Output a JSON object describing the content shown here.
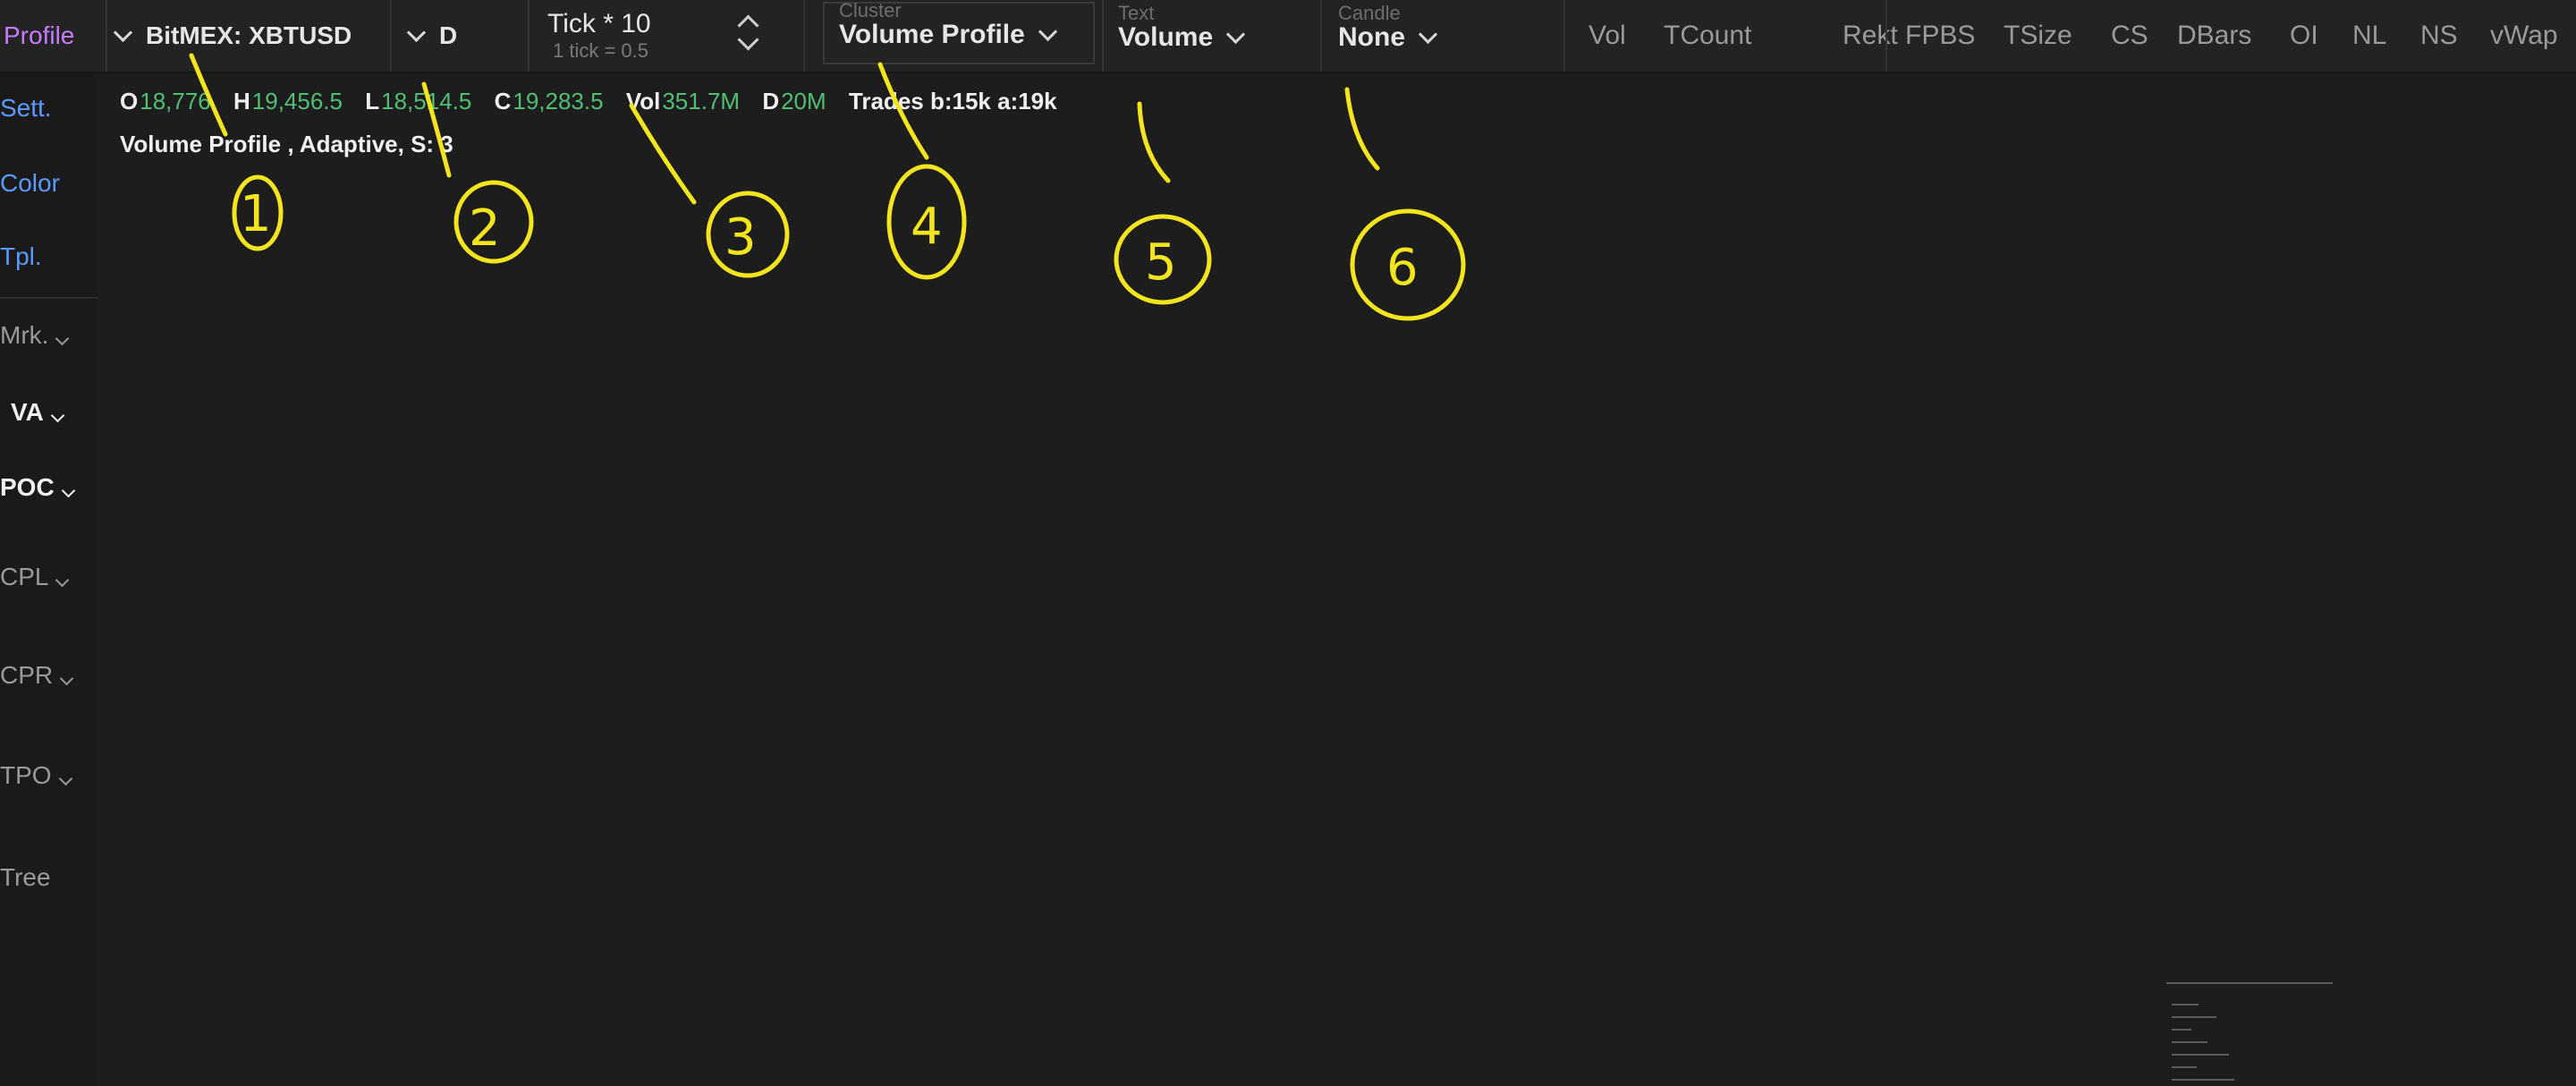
{
  "toolbar": {
    "profile_label": "Profile",
    "instrument": "BitMEX: XBTUSD",
    "timeframe": "D",
    "tick_label": "Tick * 10",
    "tick_sub": "1 tick = 0.5",
    "cluster": {
      "caption": "Cluster",
      "value": "Volume Profile"
    },
    "text": {
      "caption": "Text",
      "value": "Volume"
    },
    "candle": {
      "caption": "Candle",
      "value": "None"
    },
    "toggles": [
      "Vol",
      "TCount",
      "Rekt",
      "FPBS",
      "TSize",
      "CS",
      "DBars",
      "OI",
      "NL",
      "NS",
      "vWap"
    ]
  },
  "sidebar": {
    "items": [
      "Sett.",
      "Color",
      "Tpl.",
      "Mrk.",
      "VA",
      "POC",
      "CPL",
      "CPR",
      "TPO",
      "Tree"
    ]
  },
  "legend": {
    "open_label": "O",
    "open": "18,776",
    "high_label": "H",
    "high": "19,456.5",
    "low_label": "L",
    "low": "18,514.5",
    "close_label": "C",
    "close": "19,283.5",
    "vol_label": "Vol",
    "vol": "351.7M",
    "delta_label": "D",
    "delta": "20M",
    "trades": "Trades b:15k a:19k",
    "study": "Volume Profile , Adaptive, S: 3"
  },
  "annotations": [
    "1",
    "2",
    "3",
    "4",
    "5",
    "6"
  ],
  "colors": {
    "accent_profile": "#c77dff",
    "sidebar_link": "#5b9bff",
    "value_green": "#4fbf73",
    "annotation": "#f2e41e",
    "background": "#1d1d1d"
  }
}
